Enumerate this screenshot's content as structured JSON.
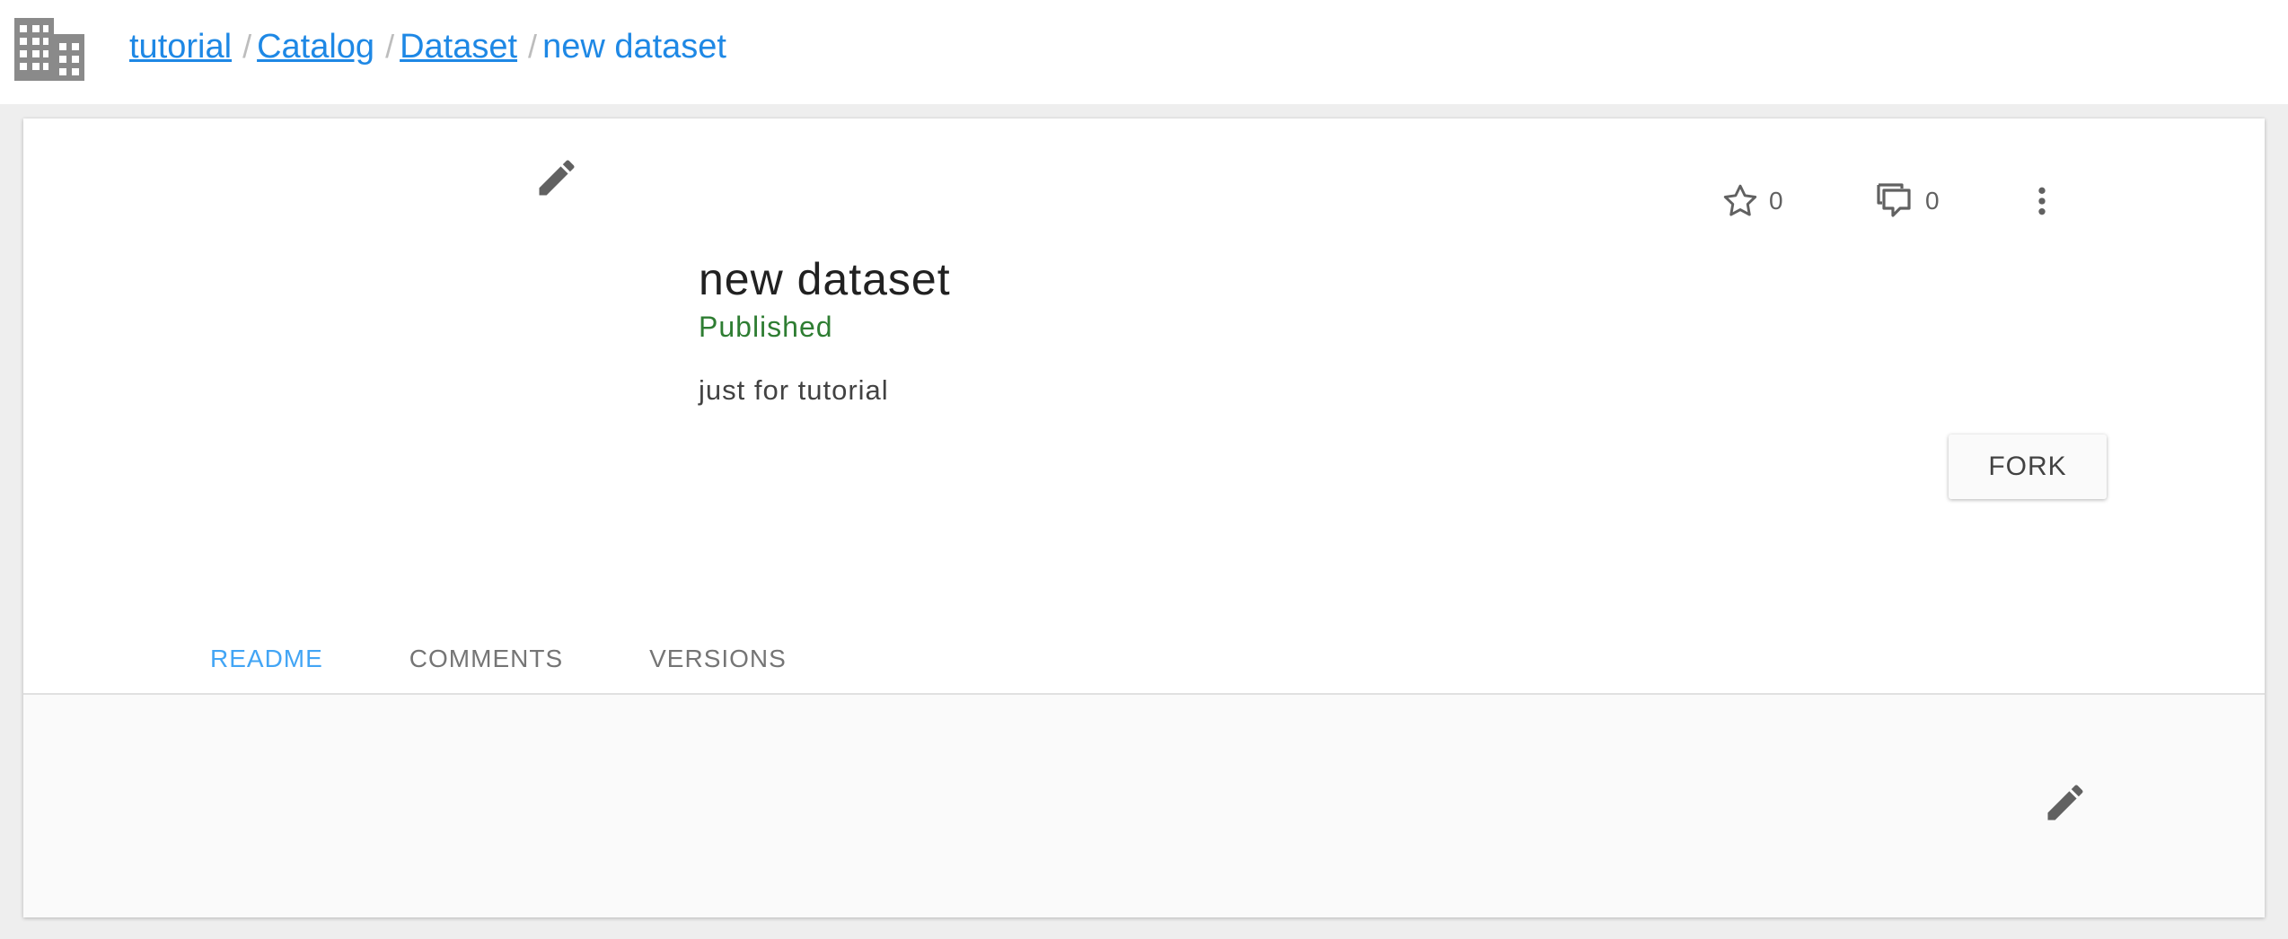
{
  "header": {
    "org_icon": "building-icon",
    "breadcrumb": {
      "items": [
        "tutorial",
        "Catalog",
        "Dataset"
      ],
      "separator": "/",
      "current": "new dataset"
    }
  },
  "dataset": {
    "title": "new dataset",
    "status": "Published",
    "description": "just for tutorial",
    "star_count": "0",
    "comment_count": "0",
    "fork_label": "FORK"
  },
  "tabs": [
    {
      "label": "README",
      "active": true
    },
    {
      "label": "COMMENTS",
      "active": false
    },
    {
      "label": "VERSIONS",
      "active": false
    }
  ],
  "icons": {
    "edit": "pencil-icon",
    "star": "star-outline-icon",
    "comments": "comments-icon",
    "more": "more-vertical-icon"
  },
  "colors": {
    "link": "#1e88e5",
    "status": "#2e7d32",
    "tab_active_text": "#42a5f5",
    "tab_indicator": "#5c6bc0",
    "icon": "#616161"
  }
}
